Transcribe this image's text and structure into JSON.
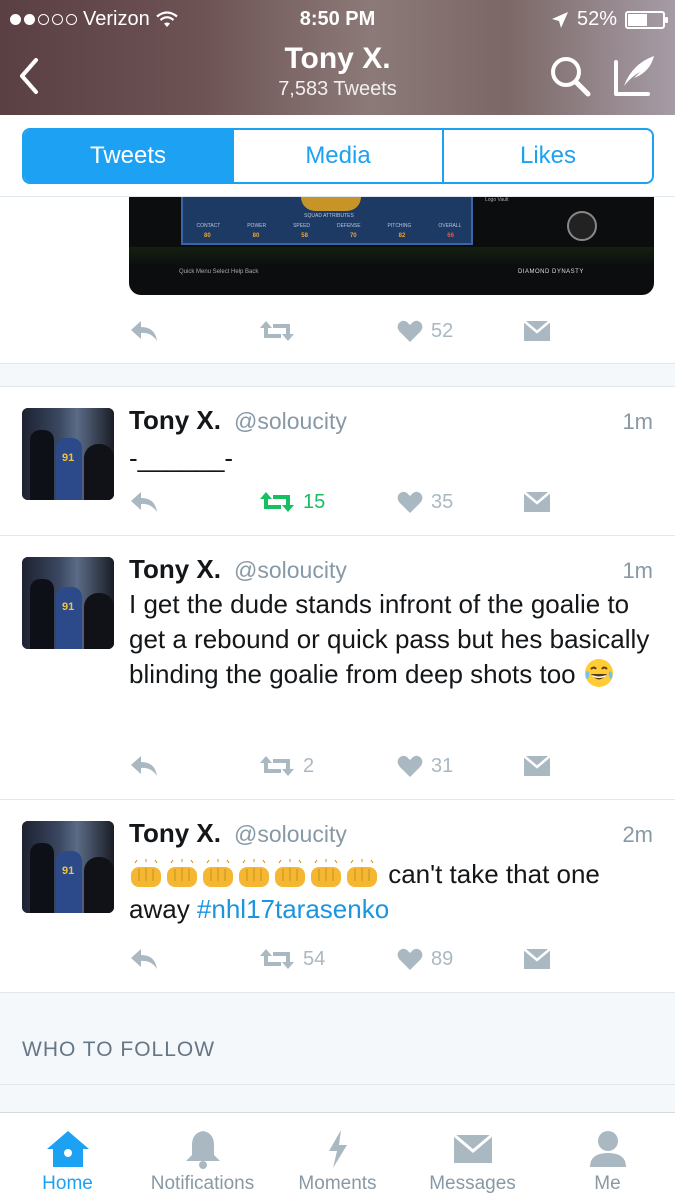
{
  "status_bar": {
    "carrier": "Verizon",
    "time": "8:50 PM",
    "battery": "52%",
    "battery_level": 0.52,
    "signal_bars_filled": 2,
    "signal_bars_total": 5
  },
  "nav": {
    "title": "Tony X.",
    "subtitle": "7,583 Tweets",
    "back_icon": "chevron-left-icon",
    "search_icon": "search-icon",
    "compose_icon": "compose-tweet-icon"
  },
  "tabs": [
    {
      "label": "Tweets",
      "active": true
    },
    {
      "label": "Media",
      "active": false
    },
    {
      "label": "Likes",
      "active": false
    }
  ],
  "media_preview": {
    "attributes_title": "SQUAD ATTRIBUTES",
    "attributes": [
      "CONTACT",
      "POWER",
      "SPEED",
      "DEFENSE",
      "PITCHING",
      "OVERALL"
    ],
    "values": [
      "80",
      "80",
      "58",
      "70",
      "82",
      "66"
    ],
    "logo_tag": "Logo Vault",
    "footer_left": "Quick Menu  Select  Help  Back",
    "footer_right": "DIAMOND DYNASTY"
  },
  "media_tweet_actions": {
    "retweets": "",
    "likes": "52"
  },
  "tweets": [
    {
      "name": "Tony X.",
      "handle": "@soloucity",
      "time": "1m",
      "text": "-______-",
      "retweets": "15",
      "likes": "35"
    },
    {
      "name": "Tony X.",
      "handle": "@soloucity",
      "time": "1m",
      "text": "I get the dude stands infront of the goalie to get a rebound or quick pass but hes basically blinding the goalie from deep shots too",
      "retweets": "2",
      "likes": "31"
    },
    {
      "name": "Tony X.",
      "handle": "@soloucity",
      "time": "2m",
      "text_after_emoji": " can't take that one away ",
      "hashtag": "#nhl17tarasenko",
      "retweets": "54",
      "likes": "89"
    }
  ],
  "who_to_follow": "WHO TO FOLLOW",
  "tabbar": [
    {
      "label": "Home",
      "icon": "home-icon",
      "active": true
    },
    {
      "label": "Notifications",
      "icon": "bell-icon",
      "active": false
    },
    {
      "label": "Moments",
      "icon": "lightning-icon",
      "active": false
    },
    {
      "label": "Messages",
      "icon": "envelope-icon",
      "active": false
    },
    {
      "label": "Me",
      "icon": "person-icon",
      "active": false
    }
  ],
  "colors": {
    "accent": "#1da1f2",
    "retweeted_green": "#17bf63",
    "action_gray": "#aab8c2",
    "hashtag_blue": "#1b95e0"
  }
}
